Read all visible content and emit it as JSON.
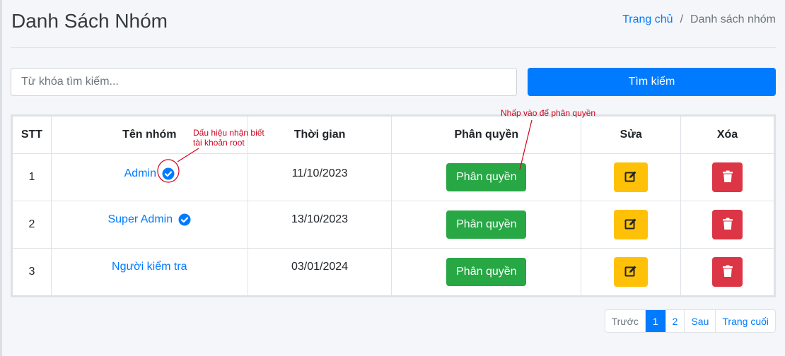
{
  "page": {
    "title": "Danh Sách Nhóm"
  },
  "breadcrumb": {
    "home": "Trang chủ",
    "separator": "/",
    "current": "Danh sách nhóm"
  },
  "search": {
    "placeholder": "Từ khóa tìm kiếm...",
    "button_label": "Tìm kiếm"
  },
  "table": {
    "headers": {
      "stt": "STT",
      "name": "Tên nhóm",
      "time": "Thời gian",
      "permission": "Phân quyền",
      "edit": "Sửa",
      "delete": "Xóa"
    },
    "rows": [
      {
        "stt": "1",
        "name": "Admin",
        "verified": true,
        "time": "11/10/2023",
        "perm_label": "Phân quyền"
      },
      {
        "stt": "2",
        "name": "Super Admin",
        "verified": true,
        "time": "13/10/2023",
        "perm_label": "Phân quyền"
      },
      {
        "stt": "3",
        "name": "Người kiểm tra",
        "verified": false,
        "time": "03/01/2024",
        "perm_label": "Phân quyền"
      }
    ]
  },
  "pagination": {
    "prev": "Trước",
    "pages": [
      "1",
      "2"
    ],
    "active": "1",
    "next": "Sau",
    "last": "Trang cuối"
  },
  "annotations": {
    "root_note_line1": "Dấu hiệu nhận biết",
    "root_note_line2": "tài khoản root",
    "perm_note": "Nhấp vào để phân quyền"
  },
  "colors": {
    "primary": "#007bff",
    "success": "#28a745",
    "warning": "#ffc107",
    "danger": "#dc3545",
    "annotation": "#d0021b"
  },
  "icons": {
    "verified": "check-circle-icon",
    "edit": "edit-icon",
    "delete": "trash-icon"
  }
}
